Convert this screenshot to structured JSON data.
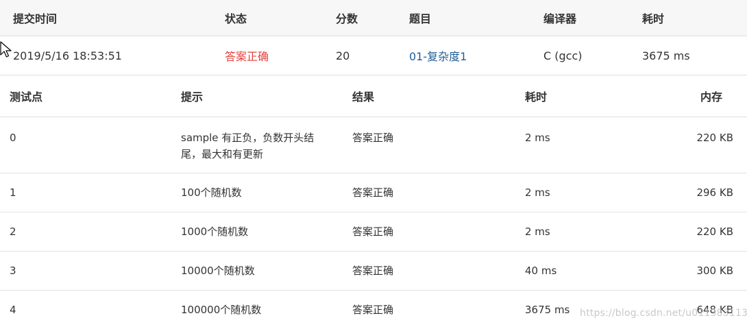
{
  "submission": {
    "headers": {
      "time": "提交时间",
      "status": "状态",
      "score": "分数",
      "problem": "题目",
      "compiler": "编译器",
      "duration": "耗时"
    },
    "row": {
      "time": "2019/5/16 18:53:51",
      "status": "答案正确",
      "score": "20",
      "problem": "01-复杂度1",
      "compiler": "C (gcc)",
      "duration": "3675 ms"
    }
  },
  "testpoints": {
    "headers": {
      "id": "测试点",
      "hint": "提示",
      "result": "结果",
      "time": "耗时",
      "memory": "内存"
    },
    "rows": [
      {
        "id": "0",
        "hint": "sample 有正负，负数开头结尾，最大和有更新",
        "result": "答案正确",
        "time": "2 ms",
        "memory": "220 KB"
      },
      {
        "id": "1",
        "hint": "100个随机数",
        "result": "答案正确",
        "time": "2 ms",
        "memory": "296 KB"
      },
      {
        "id": "2",
        "hint": "1000个随机数",
        "result": "答案正确",
        "time": "2 ms",
        "memory": "220 KB"
      },
      {
        "id": "3",
        "hint": "10000个随机数",
        "result": "答案正确",
        "time": "40 ms",
        "memory": "300 KB"
      },
      {
        "id": "4",
        "hint": "100000个随机数",
        "result": "答案正确",
        "time": "3675 ms",
        "memory": "648 KB"
      }
    ]
  },
  "watermark": "https://blog.csdn.net/u011383113",
  "colors": {
    "accepted": "#e5403a",
    "link": "#1f5d99",
    "header_bg": "#f7f7f7",
    "border": "#dddddd"
  },
  "icons": {
    "cursor": "mouse-pointer-icon"
  }
}
